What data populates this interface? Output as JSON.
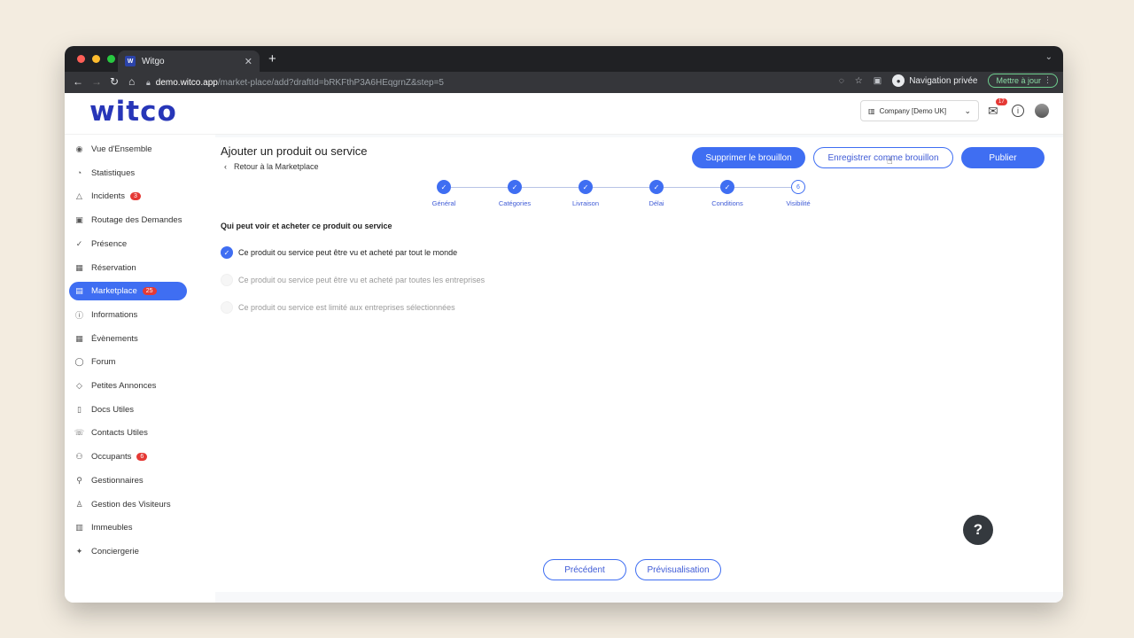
{
  "browser": {
    "tab_title": "Witgo",
    "tab_favicon": "W",
    "url_host": "demo.witco.app",
    "url_path": "/market-place/add?draftId=bRKFthP3A6HEqgrnZ&step=5",
    "private_label": "Navigation privée",
    "update_label": "Mettre à jour"
  },
  "header": {
    "logo": "witco",
    "company": "Company [Demo UK]",
    "mail_count": "17"
  },
  "sidebar": {
    "items": [
      {
        "label": "Vue d'Ensemble",
        "icon": "eye-icon"
      },
      {
        "label": "Statistiques",
        "icon": "pie-chart-icon"
      },
      {
        "label": "Incidents",
        "icon": "warning-icon",
        "badge": "3"
      },
      {
        "label": "Routage des Demandes",
        "icon": "routing-icon"
      },
      {
        "label": "Présence",
        "icon": "check-circle-icon"
      },
      {
        "label": "Réservation",
        "icon": "calendar-icon"
      },
      {
        "label": "Marketplace",
        "icon": "store-icon",
        "badge": "25",
        "active": true
      },
      {
        "label": "Informations",
        "icon": "info-icon"
      },
      {
        "label": "Évènements",
        "icon": "event-icon"
      },
      {
        "label": "Forum",
        "icon": "chat-icon"
      },
      {
        "label": "Petites Annonces",
        "icon": "tag-icon"
      },
      {
        "label": "Docs Utiles",
        "icon": "document-icon"
      },
      {
        "label": "Contacts Utiles",
        "icon": "phone-icon"
      },
      {
        "label": "Occupants",
        "icon": "users-icon",
        "badge": "6"
      },
      {
        "label": "Gestionnaires",
        "icon": "manager-icon"
      },
      {
        "label": "Gestion des Visiteurs",
        "icon": "visitor-icon"
      },
      {
        "label": "Immeubles",
        "icon": "building-icon"
      },
      {
        "label": "Conciergerie",
        "icon": "concierge-icon"
      }
    ]
  },
  "main": {
    "title": "Ajouter un produit ou service",
    "back_label": "Retour à la Marketplace",
    "delete_draft_label": "Supprimer le brouillon",
    "save_draft_label": "Enregistrer comme brouillon",
    "publish_label": "Publier",
    "steps": [
      {
        "label": "Général",
        "done": true
      },
      {
        "label": "Catégories",
        "done": true
      },
      {
        "label": "Livraison",
        "done": true
      },
      {
        "label": "Délai",
        "done": true
      },
      {
        "label": "Conditions",
        "done": true
      },
      {
        "label": "Visibilité",
        "done": false,
        "number": "6"
      }
    ],
    "question": "Qui peut voir et acheter ce produit ou service",
    "options": [
      {
        "label": "Ce produit ou service peut être vu et acheté par tout le monde",
        "checked": true
      },
      {
        "label": "Ce produit ou service peut être vu et acheté par toutes les entreprises",
        "checked": false
      },
      {
        "label": "Ce produit ou service est limité aux entreprises sélectionnées",
        "checked": false
      }
    ],
    "previous_label": "Précédent",
    "preview_label": "Prévisualisation"
  },
  "help_label": "?"
}
